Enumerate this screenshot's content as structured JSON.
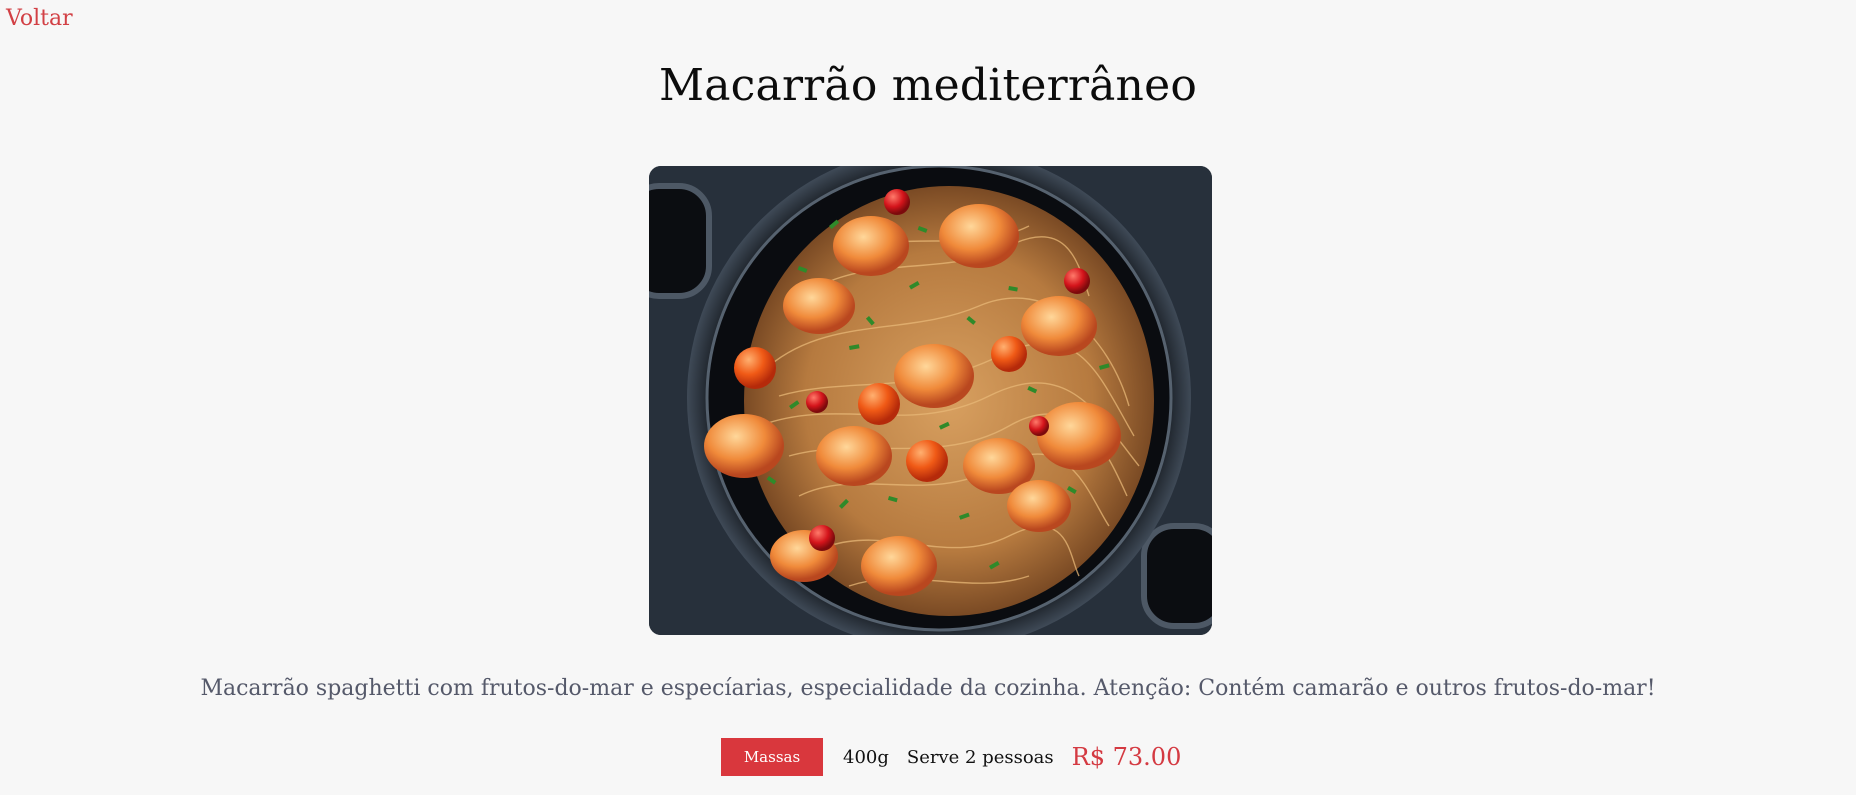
{
  "nav": {
    "back_label": "Voltar"
  },
  "product": {
    "title": "Macarrão mediterrâneo",
    "image_alt": "Macarrão mediterrâneo",
    "description": "Macarrão spaghetti com frutos-do-mar e especíarias, especialidade da cozinha. Atenção: Contém camarão e outros frutos-do-mar!",
    "category": "Massas",
    "weight": "400g",
    "serves": "Serve 2 pessoas",
    "price": "R$ 73.00"
  },
  "colors": {
    "accent": "#d9373d",
    "background": "#f7f7f7",
    "description_text": "#55596a"
  }
}
